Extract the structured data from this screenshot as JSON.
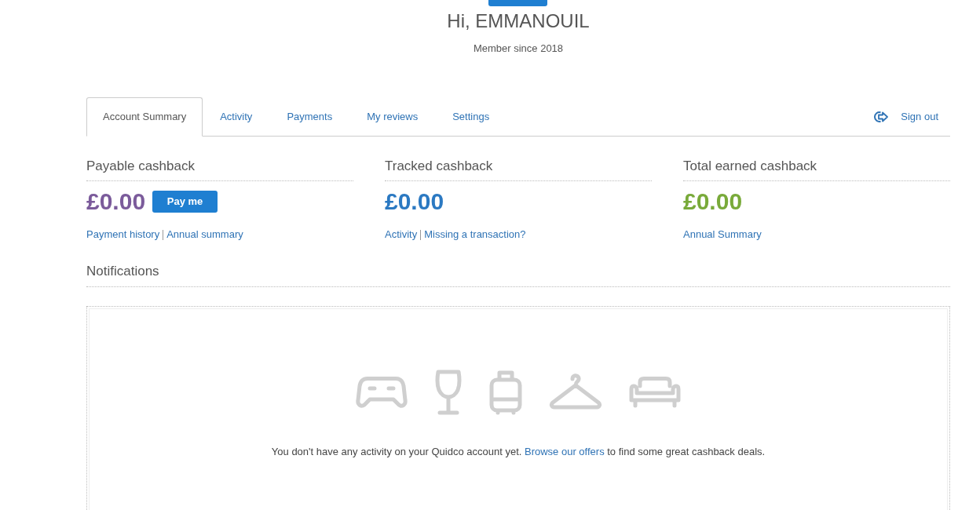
{
  "header": {
    "greeting": "Hi, EMMANOUIL",
    "member_since": "Member since 2018"
  },
  "tabs": [
    {
      "label": "Account Summary",
      "selected": true
    },
    {
      "label": "Activity",
      "selected": false
    },
    {
      "label": "Payments",
      "selected": false
    },
    {
      "label": "My reviews",
      "selected": false
    },
    {
      "label": "Settings",
      "selected": false
    }
  ],
  "sign_out": {
    "label": "Sign out"
  },
  "cashback_panels": [
    {
      "title": "Payable cashback",
      "amount": "£0.00",
      "color": "#7b5b9b",
      "button": "Pay me",
      "links": [
        "Payment history",
        "Annual summary"
      ]
    },
    {
      "title": "Tracked cashback",
      "amount": "£0.00",
      "color": "#2b79c2",
      "links": [
        "Activity",
        "Missing a transaction?"
      ]
    },
    {
      "title": "Total earned cashback",
      "amount": "£0.00",
      "color": "#79aa3a",
      "links": [
        "Annual Summary"
      ]
    }
  ],
  "notifications": {
    "title": "Notifications",
    "message": {
      "before": "You don't have any activity on your Quidco account yet.",
      "link": "Browse our offers",
      "after": "to find some great cashback deals."
    }
  }
}
